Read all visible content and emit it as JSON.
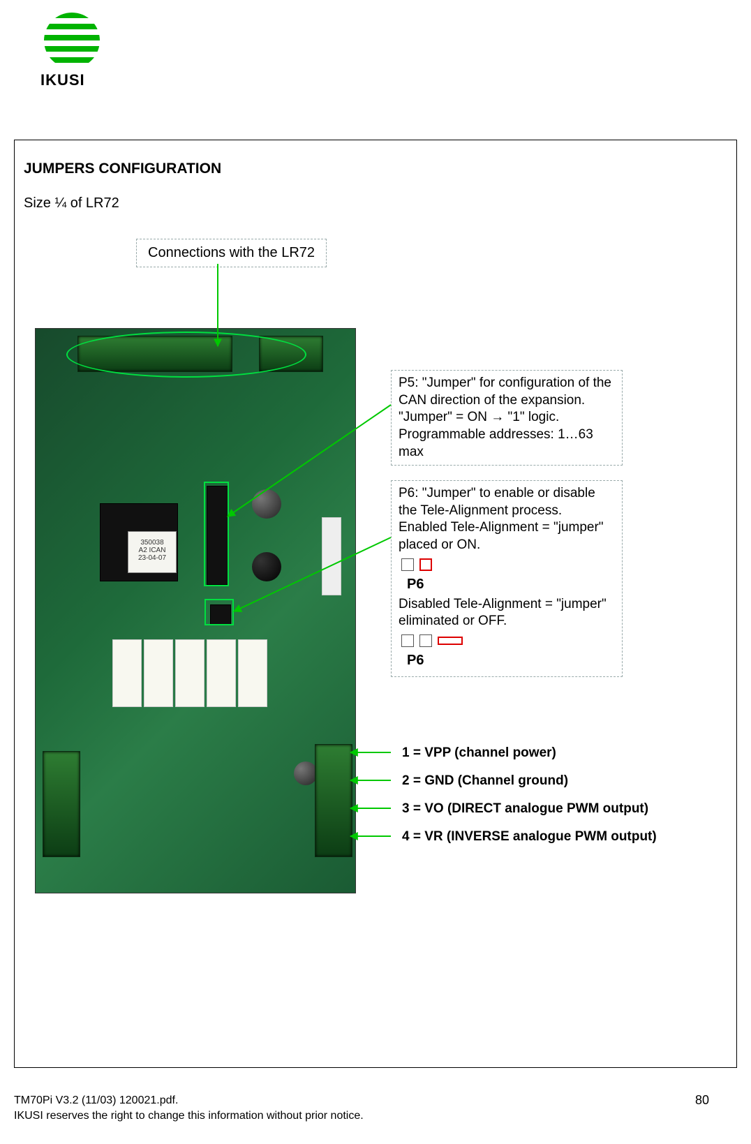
{
  "logo": {
    "brand": "IKUSI"
  },
  "title": "JUMPERS CONFIGURATION",
  "size_line": "Size ¼ of LR72",
  "connections_label": "Connections with the LR72",
  "callout_p5": "P5: \"Jumper\" for configuration of the CAN direction of the expansion. \"Jumper\" = ON → \"1\" logic. Programmable addresses: 1…63 max",
  "callout_p6": {
    "line1": "P6: \"Jumper\" to enable or disable the Tele-Alignment process.",
    "line2": "Enabled Tele-Alignment = \"jumper\" placed or ON.",
    "label1": "P6",
    "line3": "Disabled Tele-Alignment = \"jumper\" eliminated or OFF.",
    "label2": "P6"
  },
  "chip_label": {
    "l1": "350038",
    "l2": "A2 ICAN",
    "l3": "23-04-07"
  },
  "pins": {
    "p1": "1 = VPP (channel power)",
    "p2": "2 = GND (Channel ground)",
    "p3": "3 = VO (DIRECT analogue PWM output)",
    "p4": "4 = VR (INVERSE analogue PWM output)"
  },
  "footer": {
    "doc": "TM70Pi V3.2 (11/03)  120021.pdf.",
    "notice": "IKUSI  reserves the right to change this information without  prior notice.",
    "page": "80"
  }
}
